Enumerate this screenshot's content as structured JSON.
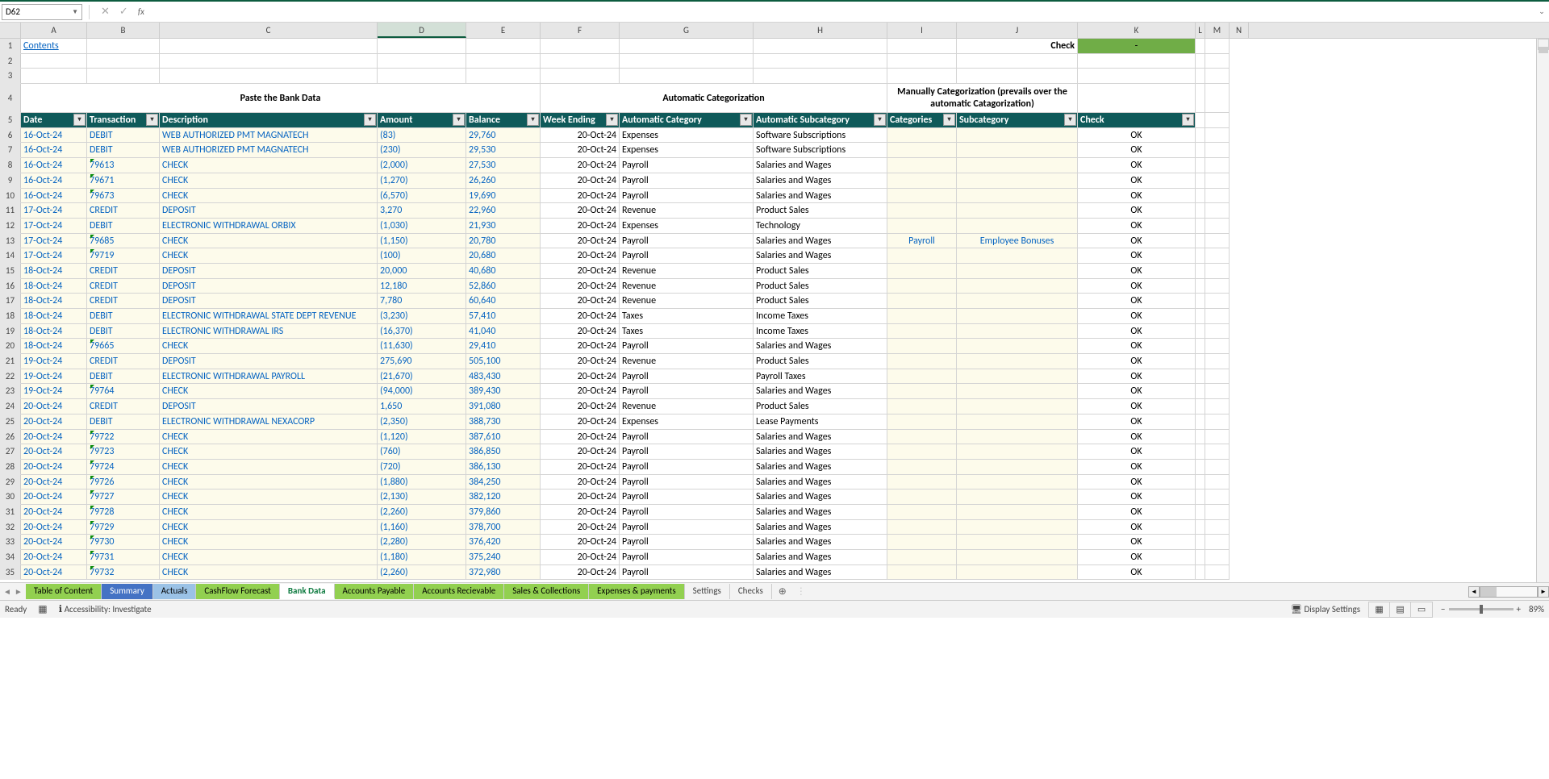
{
  "name_box": "D62",
  "formula_value": "",
  "contents_link": "Contents",
  "check_label": "Check",
  "check_value": "-",
  "paste_title": "Paste the Bank Data",
  "auto_title": "Automatic Categorization",
  "manual_title": "Manually Categorization (prevails over the automatic Catagorization)",
  "col_letters": [
    "A",
    "B",
    "C",
    "D",
    "E",
    "F",
    "G",
    "H",
    "I",
    "J",
    "K",
    "L",
    "M"
  ],
  "headers": {
    "date": "Date",
    "txn": "Transaction",
    "desc": "Description",
    "amount": "Amount",
    "balance": "Balance",
    "week": "Week Ending",
    "acat": "Automatic Category",
    "asub": "Automatic Subcategory",
    "mcat": "Categories",
    "msub": "Subcategory",
    "check": "Check"
  },
  "rows": [
    {
      "r": 6,
      "date": "16-Oct-24",
      "txn": "DEBIT",
      "desc": "WEB AUTHORIZED PMT MAGNATECH",
      "amt": "(83)",
      "bal": "29,760",
      "wk": "20-Oct-24",
      "ac": "Expenses",
      "as": "Software Subscriptions",
      "mc": "",
      "ms": "",
      "ck": "OK"
    },
    {
      "r": 7,
      "date": "16-Oct-24",
      "txn": "DEBIT",
      "desc": "WEB AUTHORIZED PMT MAGNATECH",
      "amt": "(230)",
      "bal": "29,530",
      "wk": "20-Oct-24",
      "ac": "Expenses",
      "as": "Software Subscriptions",
      "mc": "",
      "ms": "",
      "ck": "OK"
    },
    {
      "r": 8,
      "date": "16-Oct-24",
      "txn": "79613",
      "tri": true,
      "desc": "CHECK",
      "amt": "(2,000)",
      "bal": "27,530",
      "wk": "20-Oct-24",
      "ac": "Payroll",
      "as": "Salaries and Wages",
      "mc": "",
      "ms": "",
      "ck": "OK"
    },
    {
      "r": 9,
      "date": "16-Oct-24",
      "txn": "79671",
      "tri": true,
      "desc": "CHECK",
      "amt": "(1,270)",
      "bal": "26,260",
      "wk": "20-Oct-24",
      "ac": "Payroll",
      "as": "Salaries and Wages",
      "mc": "",
      "ms": "",
      "ck": "OK"
    },
    {
      "r": 10,
      "date": "16-Oct-24",
      "txn": "79673",
      "tri": true,
      "desc": "CHECK",
      "amt": "(6,570)",
      "bal": "19,690",
      "wk": "20-Oct-24",
      "ac": "Payroll",
      "as": "Salaries and Wages",
      "mc": "",
      "ms": "",
      "ck": "OK"
    },
    {
      "r": 11,
      "date": "17-Oct-24",
      "txn": "CREDIT",
      "desc": "DEPOSIT",
      "amt": "3,270",
      "bal": "22,960",
      "wk": "20-Oct-24",
      "ac": "Revenue",
      "as": "Product Sales",
      "mc": "",
      "ms": "",
      "ck": "OK"
    },
    {
      "r": 12,
      "date": "17-Oct-24",
      "txn": "DEBIT",
      "desc": "ELECTRONIC WITHDRAWAL ORBIX",
      "amt": "(1,030)",
      "bal": "21,930",
      "wk": "20-Oct-24",
      "ac": "Expenses",
      "as": "Technology",
      "mc": "",
      "ms": "",
      "ck": "OK"
    },
    {
      "r": 13,
      "date": "17-Oct-24",
      "txn": "79685",
      "tri": true,
      "desc": "CHECK",
      "amt": "(1,150)",
      "bal": "20,780",
      "wk": "20-Oct-24",
      "ac": "Payroll",
      "as": "Salaries and Wages",
      "mc": "Payroll",
      "ms": "Employee Bonuses",
      "ck": "OK"
    },
    {
      "r": 14,
      "date": "17-Oct-24",
      "txn": "79719",
      "tri": true,
      "desc": "CHECK",
      "amt": "(100)",
      "bal": "20,680",
      "wk": "20-Oct-24",
      "ac": "Payroll",
      "as": "Salaries and Wages",
      "mc": "",
      "ms": "",
      "ck": "OK"
    },
    {
      "r": 15,
      "date": "18-Oct-24",
      "txn": "CREDIT",
      "desc": "DEPOSIT",
      "amt": "20,000",
      "bal": "40,680",
      "wk": "20-Oct-24",
      "ac": "Revenue",
      "as": "Product Sales",
      "mc": "",
      "ms": "",
      "ck": "OK"
    },
    {
      "r": 16,
      "date": "18-Oct-24",
      "txn": "CREDIT",
      "desc": "DEPOSIT",
      "amt": "12,180",
      "bal": "52,860",
      "wk": "20-Oct-24",
      "ac": "Revenue",
      "as": "Product Sales",
      "mc": "",
      "ms": "",
      "ck": "OK"
    },
    {
      "r": 17,
      "date": "18-Oct-24",
      "txn": "CREDIT",
      "desc": "DEPOSIT",
      "amt": "7,780",
      "bal": "60,640",
      "wk": "20-Oct-24",
      "ac": "Revenue",
      "as": "Product Sales",
      "mc": "",
      "ms": "",
      "ck": "OK"
    },
    {
      "r": 18,
      "date": "18-Oct-24",
      "txn": "DEBIT",
      "desc": "ELECTRONIC WITHDRAWAL STATE DEPT REVENUE",
      "amt": "(3,230)",
      "bal": "57,410",
      "wk": "20-Oct-24",
      "ac": "Taxes",
      "as": "Income Taxes",
      "mc": "",
      "ms": "",
      "ck": "OK"
    },
    {
      "r": 19,
      "date": "18-Oct-24",
      "txn": "DEBIT",
      "desc": "ELECTRONIC WITHDRAWAL IRS",
      "amt": "(16,370)",
      "bal": "41,040",
      "wk": "20-Oct-24",
      "ac": "Taxes",
      "as": "Income Taxes",
      "mc": "",
      "ms": "",
      "ck": "OK"
    },
    {
      "r": 20,
      "date": "18-Oct-24",
      "txn": "79665",
      "tri": true,
      "desc": "CHECK",
      "amt": "(11,630)",
      "bal": "29,410",
      "wk": "20-Oct-24",
      "ac": "Payroll",
      "as": "Salaries and Wages",
      "mc": "",
      "ms": "",
      "ck": "OK"
    },
    {
      "r": 21,
      "date": "19-Oct-24",
      "txn": "CREDIT",
      "desc": "DEPOSIT",
      "amt": "275,690",
      "bal": "505,100",
      "wk": "20-Oct-24",
      "ac": "Revenue",
      "as": "Product Sales",
      "mc": "",
      "ms": "",
      "ck": "OK"
    },
    {
      "r": 22,
      "date": "19-Oct-24",
      "txn": "DEBIT",
      "desc": "ELECTRONIC WITHDRAWAL PAYROLL",
      "amt": "(21,670)",
      "bal": "483,430",
      "wk": "20-Oct-24",
      "ac": "Payroll",
      "as": "Payroll Taxes",
      "mc": "",
      "ms": "",
      "ck": "OK"
    },
    {
      "r": 23,
      "date": "19-Oct-24",
      "txn": "79764",
      "tri": true,
      "desc": "CHECK",
      "amt": "(94,000)",
      "bal": "389,430",
      "wk": "20-Oct-24",
      "ac": "Payroll",
      "as": "Salaries and Wages",
      "mc": "",
      "ms": "",
      "ck": "OK"
    },
    {
      "r": 24,
      "date": "20-Oct-24",
      "txn": "CREDIT",
      "desc": "DEPOSIT",
      "amt": "1,650",
      "bal": "391,080",
      "wk": "20-Oct-24",
      "ac": "Revenue",
      "as": "Product Sales",
      "mc": "",
      "ms": "",
      "ck": "OK"
    },
    {
      "r": 25,
      "date": "20-Oct-24",
      "txn": "DEBIT",
      "desc": "ELECTRONIC WITHDRAWAL NEXACORP",
      "amt": "(2,350)",
      "bal": "388,730",
      "wk": "20-Oct-24",
      "ac": "Expenses",
      "as": "Lease Payments",
      "mc": "",
      "ms": "",
      "ck": "OK"
    },
    {
      "r": 26,
      "date": "20-Oct-24",
      "txn": "79722",
      "tri": true,
      "desc": "CHECK",
      "amt": "(1,120)",
      "bal": "387,610",
      "wk": "20-Oct-24",
      "ac": "Payroll",
      "as": "Salaries and Wages",
      "mc": "",
      "ms": "",
      "ck": "OK"
    },
    {
      "r": 27,
      "date": "20-Oct-24",
      "txn": "79723",
      "tri": true,
      "desc": "CHECK",
      "amt": "(760)",
      "bal": "386,850",
      "wk": "20-Oct-24",
      "ac": "Payroll",
      "as": "Salaries and Wages",
      "mc": "",
      "ms": "",
      "ck": "OK"
    },
    {
      "r": 28,
      "date": "20-Oct-24",
      "txn": "79724",
      "tri": true,
      "desc": "CHECK",
      "amt": "(720)",
      "bal": "386,130",
      "wk": "20-Oct-24",
      "ac": "Payroll",
      "as": "Salaries and Wages",
      "mc": "",
      "ms": "",
      "ck": "OK"
    },
    {
      "r": 29,
      "date": "20-Oct-24",
      "txn": "79726",
      "tri": true,
      "desc": "CHECK",
      "amt": "(1,880)",
      "bal": "384,250",
      "wk": "20-Oct-24",
      "ac": "Payroll",
      "as": "Salaries and Wages",
      "mc": "",
      "ms": "",
      "ck": "OK"
    },
    {
      "r": 30,
      "date": "20-Oct-24",
      "txn": "79727",
      "tri": true,
      "desc": "CHECK",
      "amt": "(2,130)",
      "bal": "382,120",
      "wk": "20-Oct-24",
      "ac": "Payroll",
      "as": "Salaries and Wages",
      "mc": "",
      "ms": "",
      "ck": "OK"
    },
    {
      "r": 31,
      "date": "20-Oct-24",
      "txn": "79728",
      "tri": true,
      "desc": "CHECK",
      "amt": "(2,260)",
      "bal": "379,860",
      "wk": "20-Oct-24",
      "ac": "Payroll",
      "as": "Salaries and Wages",
      "mc": "",
      "ms": "",
      "ck": "OK"
    },
    {
      "r": 32,
      "date": "20-Oct-24",
      "txn": "79729",
      "tri": true,
      "desc": "CHECK",
      "amt": "(1,160)",
      "bal": "378,700",
      "wk": "20-Oct-24",
      "ac": "Payroll",
      "as": "Salaries and Wages",
      "mc": "",
      "ms": "",
      "ck": "OK"
    },
    {
      "r": 33,
      "date": "20-Oct-24",
      "txn": "79730",
      "tri": true,
      "desc": "CHECK",
      "amt": "(2,280)",
      "bal": "376,420",
      "wk": "20-Oct-24",
      "ac": "Payroll",
      "as": "Salaries and Wages",
      "mc": "",
      "ms": "",
      "ck": "OK"
    },
    {
      "r": 34,
      "date": "20-Oct-24",
      "txn": "79731",
      "tri": true,
      "desc": "CHECK",
      "amt": "(1,180)",
      "bal": "375,240",
      "wk": "20-Oct-24",
      "ac": "Payroll",
      "as": "Salaries and Wages",
      "mc": "",
      "ms": "",
      "ck": "OK"
    },
    {
      "r": 35,
      "date": "20-Oct-24",
      "txn": "79732",
      "tri": true,
      "desc": "CHECK",
      "amt": "(2,260)",
      "bal": "372,980",
      "wk": "20-Oct-24",
      "ac": "Payroll",
      "as": "Salaries and Wages",
      "mc": "",
      "ms": "",
      "ck": "OK"
    }
  ],
  "tabs": [
    {
      "label": "Table of Content",
      "cls": "green"
    },
    {
      "label": "Summary",
      "cls": "blue-bg"
    },
    {
      "label": "Actuals",
      "cls": "cyan"
    },
    {
      "label": "CashFlow Forecast",
      "cls": "green"
    },
    {
      "label": "Bank Data",
      "cls": "active"
    },
    {
      "label": "Accounts Payable",
      "cls": "green"
    },
    {
      "label": "Accounts Recievable",
      "cls": "green"
    },
    {
      "label": "Sales & Collections",
      "cls": "green"
    },
    {
      "label": "Expenses & payments",
      "cls": "green"
    },
    {
      "label": "Settings",
      "cls": "plain"
    },
    {
      "label": "Checks",
      "cls": "plain"
    }
  ],
  "status": {
    "ready": "Ready",
    "accessibility": "Accessibility: Investigate",
    "display_settings": "Display Settings",
    "zoom": "89%"
  }
}
